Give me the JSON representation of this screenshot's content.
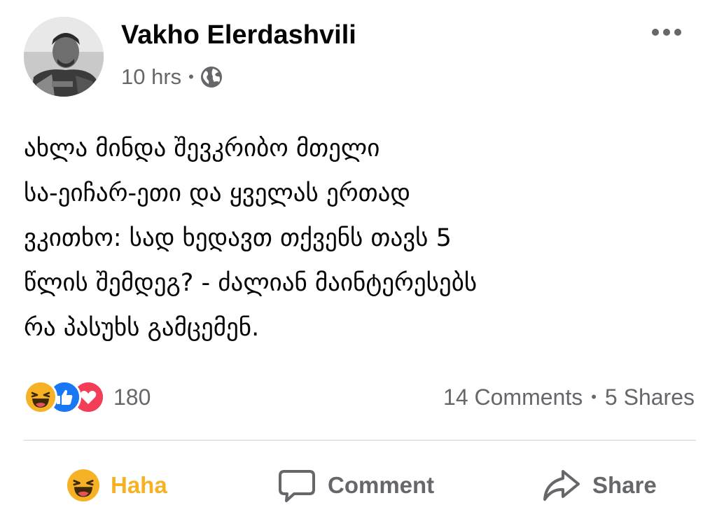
{
  "post": {
    "author": "Vakho Elerdashvili",
    "time": "10 hrs",
    "separator": "•",
    "audience_icon": "globe-icon",
    "text_lines": [
      "ახლა მინდა შევკრიბო მთელი",
      "სა-ეიჩარ-ეთი და ყველას ერთად",
      "ვკითხო: სად ხედავთ თქვენს თავს 5",
      "წლის შემდეგ? - ძალიან მაინტერესებს",
      "რა პასუხს გამცემენ."
    ]
  },
  "reactions": {
    "icons": [
      "haha-icon",
      "like-icon",
      "love-icon"
    ],
    "count": "180"
  },
  "stats": {
    "comments": "14 Comments",
    "separator": "•",
    "shares": "5 Shares"
  },
  "actions": {
    "haha_label": "Haha",
    "comment_label": "Comment",
    "share_label": "Share"
  },
  "colors": {
    "text": "#050505",
    "secondary": "#65676b",
    "haha": "#f7b125",
    "like": "#1877f2",
    "love": "#f33e58",
    "divider": "#ced0d4"
  }
}
